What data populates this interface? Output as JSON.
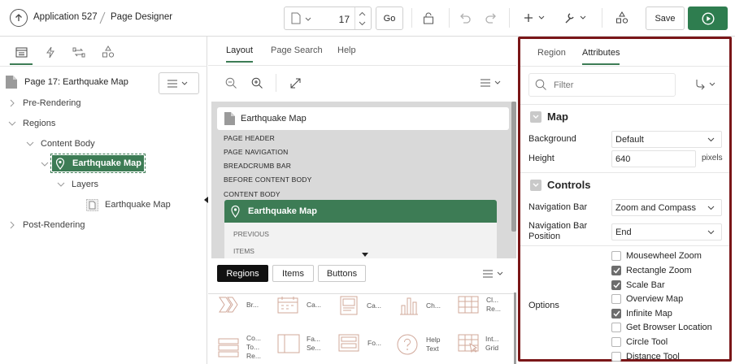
{
  "header": {
    "app_label": "Application 527",
    "page_designer_label": "Page Designer",
    "page_number": "17",
    "go_label": "Go",
    "save_label": "Save"
  },
  "left": {
    "page_title": "Page 17: Earthquake Map",
    "tree": {
      "pre_rendering": "Pre-Rendering",
      "regions": "Regions",
      "content_body": "Content Body",
      "selected_region": "Earthquake Map",
      "layers": "Layers",
      "layer_item": "Earthquake Map",
      "post_rendering": "Post-Rendering"
    }
  },
  "middle": {
    "tabs": [
      "Layout",
      "Page Search",
      "Help"
    ],
    "page_name": "Earthquake Map",
    "slots": [
      "PAGE HEADER",
      "PAGE NAVIGATION",
      "BREADCRUMB BAR",
      "BEFORE CONTENT BODY",
      "CONTENT BODY"
    ],
    "region_title": "Earthquake Map",
    "region_slots": [
      "PREVIOUS",
      "ITEMS"
    ],
    "gallery_tabs": [
      "Regions",
      "Items",
      "Buttons"
    ],
    "gallery_items": [
      {
        "label": "Br...",
        "icon": "breadcrumb-icon"
      },
      {
        "label": "Ca...",
        "icon": "calendar-icon"
      },
      {
        "label": "Ca...",
        "icon": "card-icon"
      },
      {
        "label": "Ch...",
        "icon": "chart-icon"
      },
      {
        "label": "Cl... Re...",
        "icon": "classic-report-icon"
      },
      {
        "label": "Co... To... Re...",
        "icon": "content-row-icon"
      },
      {
        "label": "Fa... Se...",
        "icon": "faceted-search-icon"
      },
      {
        "label": "Fo...",
        "icon": "form-icon"
      },
      {
        "label": "Help Text",
        "icon": "help-text-icon"
      },
      {
        "label": "Int... Grid",
        "icon": "interactive-grid-icon"
      }
    ]
  },
  "right": {
    "tabs": [
      "Region",
      "Attributes"
    ],
    "filter_placeholder": "Filter",
    "map_section": "Map",
    "background_label": "Background",
    "background_value": "Default",
    "height_label": "Height",
    "height_value": "640",
    "height_unit": "pixels",
    "controls_section": "Controls",
    "nav_bar_label": "Navigation Bar",
    "nav_bar_value": "Zoom and Compass",
    "nav_bar_pos_label": "Navigation Bar Position",
    "nav_bar_pos_value": "End",
    "options_label": "Options",
    "options": [
      {
        "label": "Mousewheel Zoom",
        "checked": false
      },
      {
        "label": "Rectangle Zoom",
        "checked": true
      },
      {
        "label": "Scale Bar",
        "checked": true
      },
      {
        "label": "Overview Map",
        "checked": false
      },
      {
        "label": "Infinite Map",
        "checked": true
      },
      {
        "label": "Get Browser Location",
        "checked": false
      },
      {
        "label": "Circle Tool",
        "checked": false
      },
      {
        "label": "Distance Tool",
        "checked": false
      }
    ]
  },
  "colors": {
    "accent_green": "#3d7c55",
    "highlight_border": "#7a1618",
    "run_button": "#2e7d4f"
  }
}
